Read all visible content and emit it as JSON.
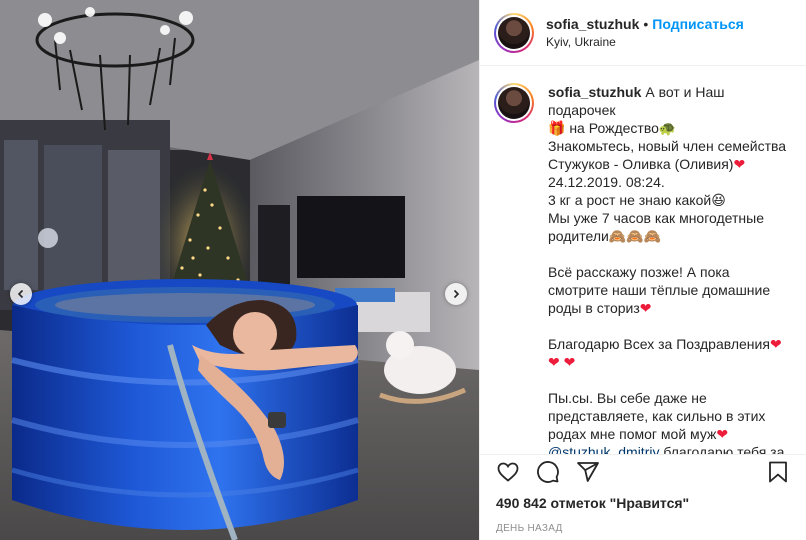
{
  "post": {
    "username": "sofia_stuzhuk",
    "separator": "•",
    "follow_label": "Подписаться",
    "location": "Kyiv, Ukraine"
  },
  "caption": {
    "username": "sofia_stuzhuk",
    "line1": "А вот и Наш подарочек",
    "line2": "🎁 на Рождество🐢",
    "line3": "Знакомьтесь, новый член семейства",
    "line4": "Стужуков - Оливка (Оливия)",
    "line4_emoji": "❤",
    "line5": "24.12.2019. 08:24.",
    "line6": "3 кг а рост не знаю какой😆",
    "line7": "Мы уже 7 часов как многодетные",
    "line8": "родители🙈🙈🙈",
    "para2_line1": "Всё расскажу позже! А пока",
    "para2_line2": "смотрите наши тёплые домашние",
    "para2_line3": "роды в сториз",
    "para2_emoji": "❤",
    "para3_line1": "Благодарю Всех за Поздравления",
    "para3_emoji1": "❤",
    "para3_line2": "❤ ❤",
    "para4_line1": "Пы.сы. Вы себе даже не",
    "para4_line2": "представляете, как сильно в этих",
    "para4_line3": "родах мне помог мой муж",
    "para4_emoji": "❤",
    "mention": "@stuzhuk_dmitriy",
    "para4_line4_rest": " благодарю тебя за"
  },
  "actions": {
    "icons": [
      "heart-icon",
      "comment-icon",
      "share-icon",
      "bookmark-icon"
    ],
    "likes": "490 842 отметок \"Нравится\"",
    "time": "день назад"
  },
  "carousel": {
    "prev_icon": "chevron-left-icon",
    "next_icon": "chevron-right-icon"
  },
  "colors": {
    "accent": "#0095f6",
    "text": "#262626",
    "muted": "#8e8e8e",
    "heart": "#ed1c3a"
  }
}
